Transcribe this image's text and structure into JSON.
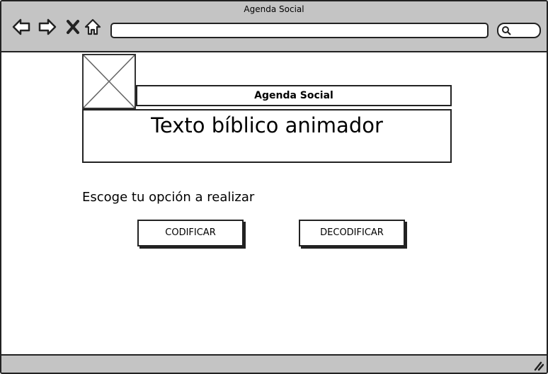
{
  "window": {
    "title": "Agenda Social"
  },
  "browser": {
    "icons": [
      "back-arrow-icon",
      "forward-arrow-icon",
      "close-x-icon",
      "home-icon",
      "search-icon",
      "resize-grip-icon"
    ],
    "url_value": "",
    "search_value": ""
  },
  "page": {
    "header": "Agenda Social",
    "text_box": "Texto bíblico animador",
    "prompt": "Escoge tu opción a realizar",
    "buttons": {
      "codificar": "CODIFICAR",
      "decodificar": "DECODIFICAR"
    }
  }
}
